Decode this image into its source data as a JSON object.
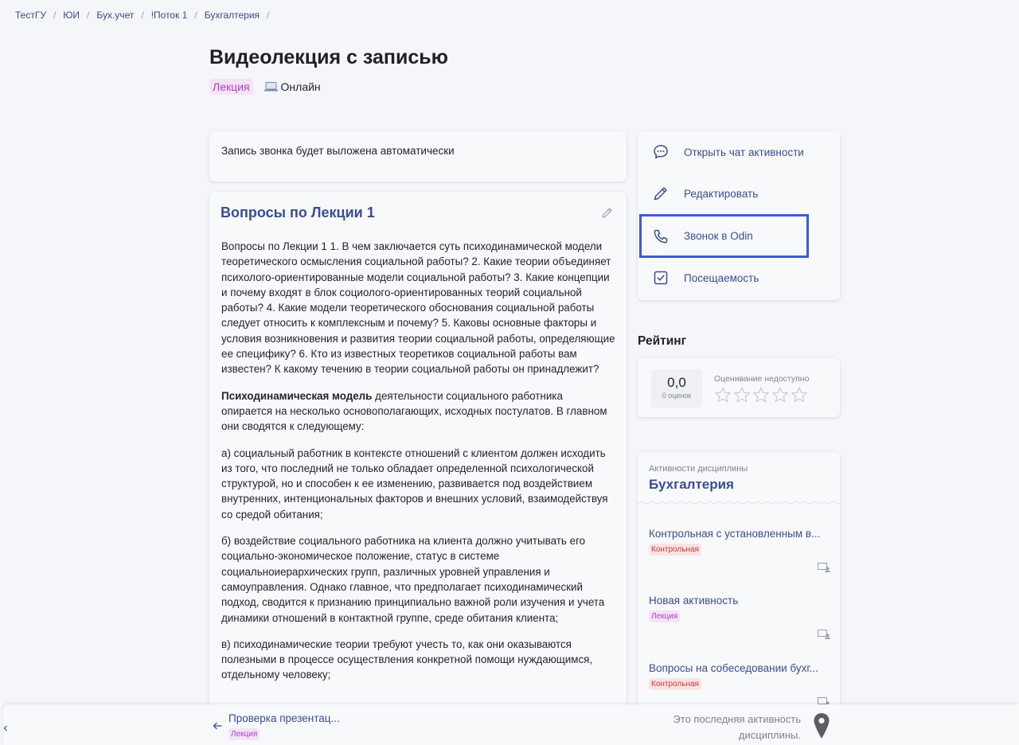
{
  "breadcrumb": [
    "ТестГУ",
    "ЮИ",
    "Бух.учет",
    "!Поток 1",
    "Бухгалтерия"
  ],
  "page": {
    "title": "Видеолекция с записью",
    "type_tag": "Лекция",
    "format": "Онлайн"
  },
  "notice": "Запись звонка будет выложена автоматически",
  "content": {
    "title": "Вопросы по Лекции 1",
    "paragraph1": "Вопросы по Лекции 1  1. В чем заключается суть психодинамической модели теоретического осмысления социальной работы?  2. Какие теории объединяет психолого-ориентированные модели социальной работы?  3. Какие концепции и почему входят в блок социолого-ориентированных теорий социальной работы?  4. Какие модели теоретического обоснования социальной работы следует относить к комплексным и почему?  5. Каковы основные факторы и условия возникновения и развития теории социальной работы, определяющие ее специфику?  6. Кто из известных теоретиков социальной работы вам известен? К какому течению в теории социальной работы он принадлежит?",
    "paragraph2_bold": "Психодинамическая модель",
    "paragraph2_rest": " деятельности социального работника опирается на несколько основополагающих, исходных постулатов. В главном они сводятся к следующему:",
    "paragraph3": "а) социальный работник в контексте отношений с клиентом должен исходить из того, что последний не только обладает определенной психологической структурой, но и способен к ее изменению, развивается под воздействием внутренних, интенциональных факторов и внешних условий, взаимодействуя со средой обитания;",
    "paragraph4": "б) воздействие социального работника на клиента должно учитывать его социально-экономическое положение, статус в системе социальноиерархических групп, различных уровней управления и самоуправления. Однако главное, что предполагает психодинамический подход, сводится к признанию принципиально важной роли изучения и учета динамики отношений в контактной группе, среде обитания клиента;",
    "paragraph5": "в) психодинамические теории требуют учесть то, как они оказываются полезными в процессе осуществления конкретной помощи нуждающимся, отдельному человеку;"
  },
  "actions": {
    "open_chat": "Открыть чат активности",
    "edit": "Редактировать",
    "call": "Звонок в Odin",
    "attendance": "Посещаемость"
  },
  "rating": {
    "title": "Рейтинг",
    "score": "0,0",
    "count": "0 оценок",
    "unavailable": "Оценивание недоступно",
    "stars_filled": 0,
    "stars_total": 5
  },
  "discipline": {
    "subtitle": "Активности дисциплины",
    "title": "Бухгалтерия",
    "items": [
      {
        "name": "Контрольная с установленным временем",
        "display_name": "Контрольная с установленным в...",
        "tag": "Контрольная"
      },
      {
        "name": "Новая активность",
        "display_name": "Новая активность",
        "tag": "Лекция"
      },
      {
        "name": "Вопросы на собеседовании бухгалтера",
        "display_name": "Вопросы на собеседовании бухг...",
        "tag": "Контрольная"
      }
    ]
  },
  "bottom": {
    "prev_name": "Проверка презентац...",
    "prev_tag": "Лекция",
    "last_note": "Это последняя активность дисциплины."
  },
  "colors": {
    "accent": "#3b4d91",
    "highlight_border": "#3f5bd6",
    "lecture_tag_bg": "#f4e3f7",
    "lecture_tag_fg": "#b13fc6",
    "control_tag_bg": "#fbe3e3",
    "control_tag_fg": "#c93a3a"
  },
  "icons": {
    "chat": "chat-bubble-icon",
    "edit": "pencil-icon",
    "call": "phone-icon",
    "attendance": "checkbox-icon",
    "online": "laptop-icon",
    "pin": "map-pin-icon"
  }
}
